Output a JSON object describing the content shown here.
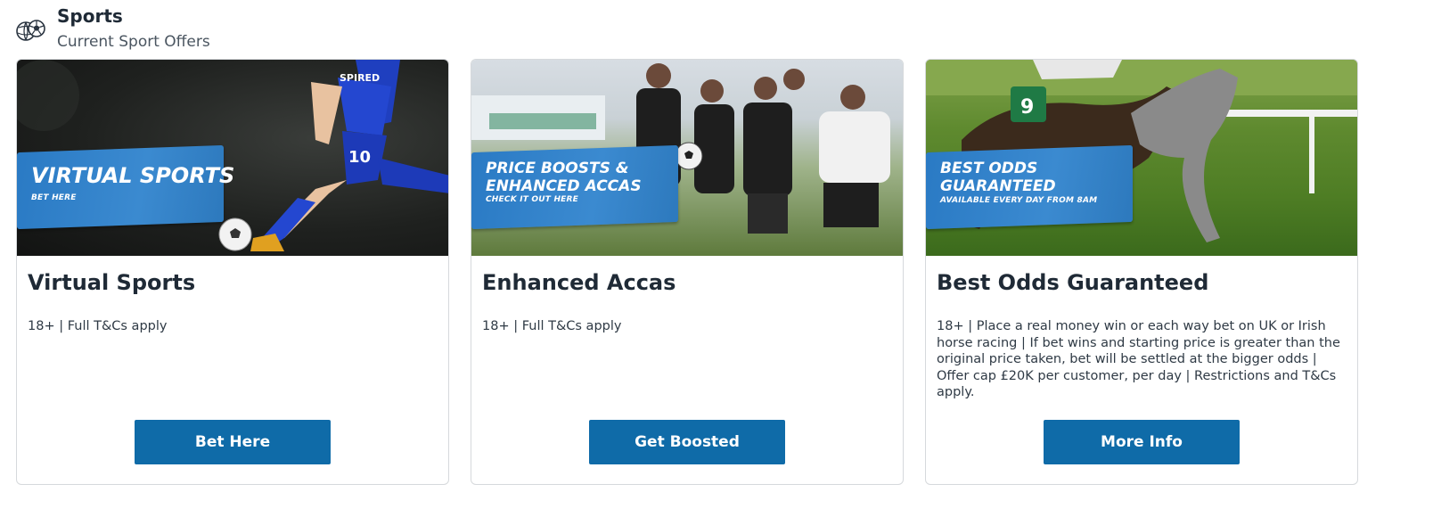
{
  "section": {
    "icon": "sports-balls-icon",
    "title": "Sports",
    "subtitle": "Current Sport Offers"
  },
  "cards": [
    {
      "image": {
        "banner_heading": "VIRTUAL SPORTS",
        "banner_sub": "BET HERE",
        "shirt_text": "SPIRED",
        "shirt_number": "10"
      },
      "title": "Virtual Sports",
      "description": "18+ | Full T&Cs apply",
      "button": "Bet Here"
    },
    {
      "image": {
        "banner_heading_line1": "PRICE BOOSTS &",
        "banner_heading_line2": "ENHANCED ACCAS",
        "banner_sub": "CHECK IT OUT HERE"
      },
      "title": "Enhanced Accas",
      "description": "18+ | Full T&Cs apply",
      "button": "Get Boosted"
    },
    {
      "image": {
        "banner_heading_line1": "BEST ODDS",
        "banner_heading_line2": "GUARANTEED",
        "banner_sub": "AVAILABLE EVERY DAY FROM 8AM",
        "saddle_number": "9"
      },
      "title": "Best Odds Guaranteed",
      "description": "18+ | Place a real money win or each way bet on UK or Irish horse racing | If bet wins and starting price is greater than the original price taken, bet will be settled at the bigger odds | Offer cap £20K per customer, per day | Restrictions and T&Cs apply.",
      "button": "More Info"
    }
  ],
  "colors": {
    "button": "#0f6ba8",
    "banner": "#2f80c8",
    "card_border": "#d6d9dc"
  }
}
